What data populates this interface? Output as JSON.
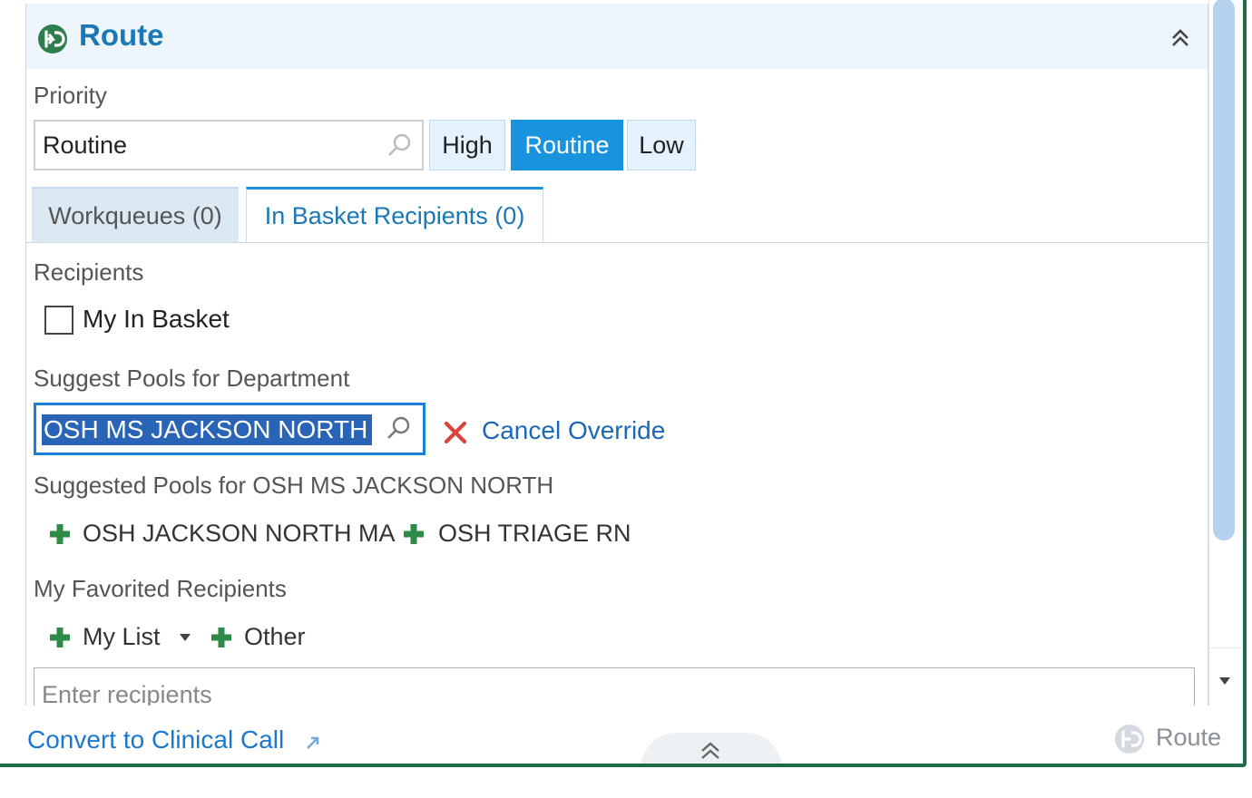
{
  "header": {
    "title": "Route"
  },
  "priority": {
    "label": "Priority",
    "value": "Routine",
    "buttons": [
      "High",
      "Routine",
      "Low"
    ],
    "selected": "Routine"
  },
  "tabs": [
    {
      "label": "Workqueues (0)",
      "active": false
    },
    {
      "label": "In Basket Recipients (0)",
      "active": true
    }
  ],
  "recipients": {
    "label": "Recipients",
    "checkbox_label": "My In Basket",
    "checked": false
  },
  "suggest": {
    "label": "Suggest Pools for Department",
    "department_value": "OSH MS JACKSON NORTH",
    "cancel_label": "Cancel Override",
    "suggested_label": "Suggested Pools for OSH MS JACKSON NORTH",
    "pools": [
      "OSH JACKSON NORTH MA",
      "OSH TRIAGE RN"
    ]
  },
  "favorites": {
    "label": "My Favorited Recipients",
    "my_list": "My List",
    "other": "Other"
  },
  "recipient_input": {
    "placeholder": "Enter recipients"
  },
  "footer": {
    "convert_label": "Convert to Clinical Call",
    "route_label": "Route"
  },
  "colors": {
    "accent": "#1a93de",
    "title": "#1a78b6",
    "frame": "#1f6b45",
    "plus": "#2e8b47",
    "cancel_x": "#d9443a"
  },
  "icons": [
    "route-logo-icon",
    "double-chevron-up-icon",
    "search-icon",
    "close-icon",
    "plus-icon",
    "dropdown-arrow-icon",
    "external-link-icon"
  ]
}
